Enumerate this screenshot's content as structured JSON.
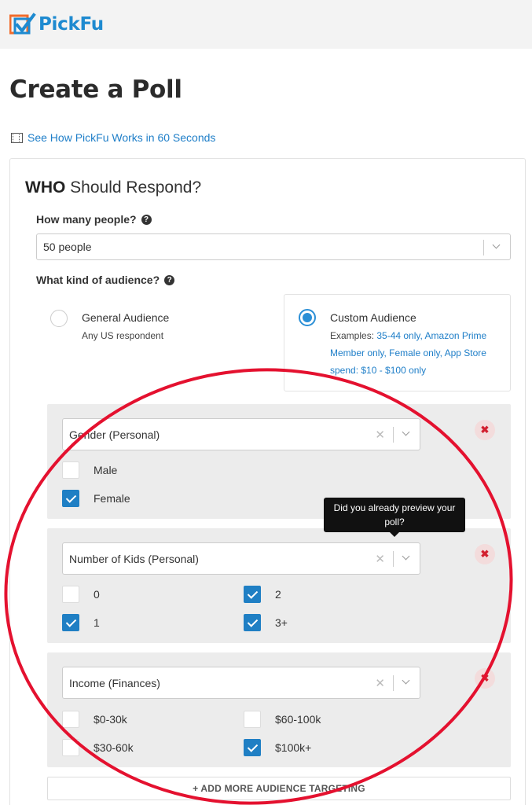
{
  "header": {
    "logo_text": "PickFu",
    "brand_color": "#1e8ad0",
    "logo_accent": "#f26b2a"
  },
  "page": {
    "title": "Create a Poll",
    "video_link": "See How PickFu Works in 60 Seconds"
  },
  "who": {
    "bold": "WHO",
    "rest": " Should Respond?"
  },
  "people": {
    "label": "How many people?",
    "value": "50 people"
  },
  "audience": {
    "label": "What kind of audience?",
    "general": {
      "title": "General Audience",
      "sub": "Any US respondent",
      "selected": false
    },
    "custom": {
      "title": "Custom Audience",
      "selected": true,
      "examples_prefix": "Examples: ",
      "examples": "35-44 only, Amazon Prime Member only, Female only, App Store spend: $10 - $100 only"
    }
  },
  "filters": [
    {
      "name": "Gender (Personal)",
      "options": [
        {
          "label": "Male",
          "checked": false
        },
        {
          "label": "Female",
          "checked": true
        }
      ]
    },
    {
      "name": "Number of Kids (Personal)",
      "options": [
        {
          "label": "0",
          "checked": false
        },
        {
          "label": "1",
          "checked": true
        },
        {
          "label": "2",
          "checked": true
        },
        {
          "label": "3+",
          "checked": true
        }
      ]
    },
    {
      "name": "Income (Finances)",
      "options": [
        {
          "label": "$0-30k",
          "checked": false
        },
        {
          "label": "$30-60k",
          "checked": false
        },
        {
          "label": "$60-100k",
          "checked": false
        },
        {
          "label": "$100k+",
          "checked": true
        }
      ]
    }
  ],
  "tooltip": {
    "text": "Did you already preview your poll?"
  },
  "add_more": {
    "label": "+ ADD MORE AUDIENCE TARGETING"
  },
  "colors": {
    "annotation_circle": "#e4112f",
    "checkbox_blue": "#1f7fc4",
    "remove_red": "#d2202f"
  }
}
